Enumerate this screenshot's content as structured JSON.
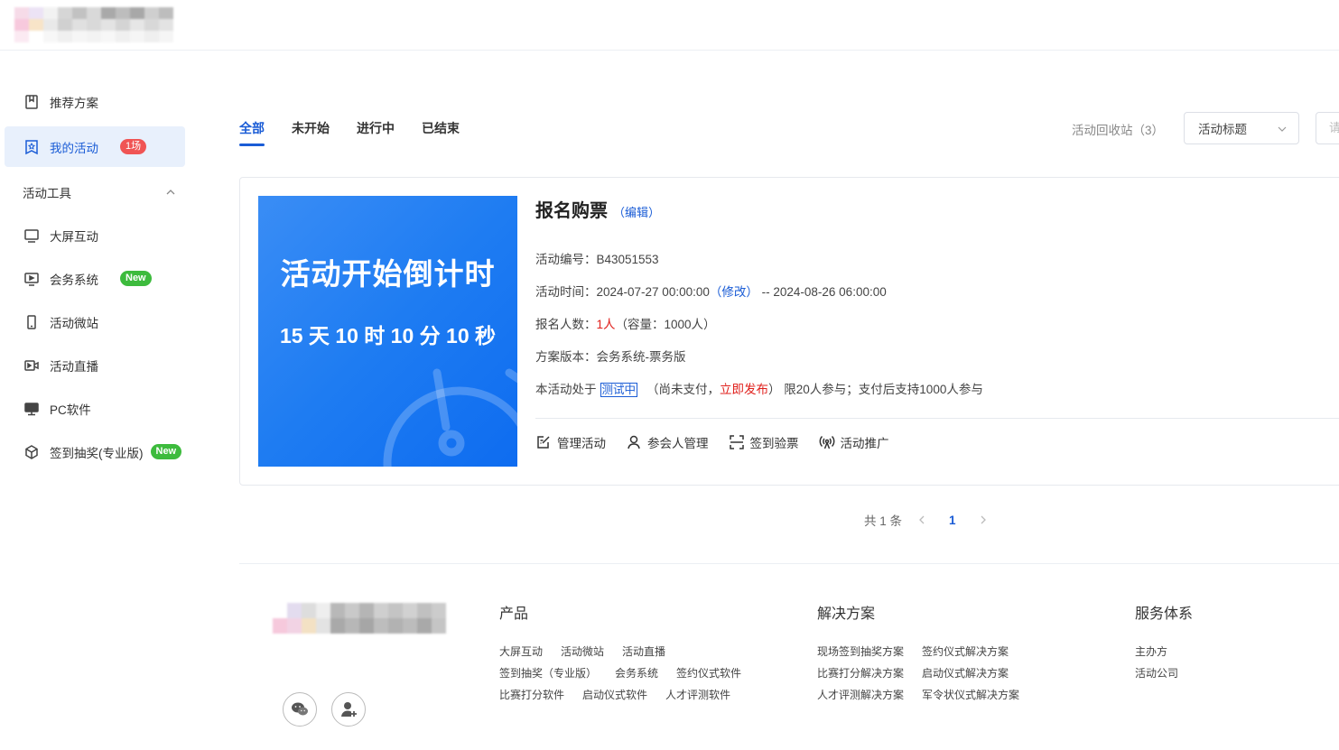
{
  "sidebar": {
    "items": [
      {
        "label": "推荐方案",
        "icon": "bookmark-icon"
      },
      {
        "label": "我的活动",
        "icon": "star-bookmark-icon",
        "badge": "1场"
      },
      {
        "label": "大屏互动",
        "icon": "monitor-icon"
      },
      {
        "label": "会务系统",
        "icon": "screen-play-icon",
        "badge": "New"
      },
      {
        "label": "活动微站",
        "icon": "phone-icon"
      },
      {
        "label": "活动直播",
        "icon": "video-icon"
      },
      {
        "label": "PC软件",
        "icon": "desktop-icon"
      },
      {
        "label": "签到抽奖(专业版)",
        "icon": "cube-icon",
        "badge": "New"
      }
    ],
    "group_label": "活动工具"
  },
  "tabs": [
    "全部",
    "未开始",
    "进行中",
    "已结束"
  ],
  "toolbar": {
    "recycle_label": "活动回收站（3）",
    "select_value": "活动标题",
    "search_placeholder": "请"
  },
  "event": {
    "cover_title": "活动开始倒计时",
    "cover_countdown": "15 天 10 时 10 分 10 秒",
    "title": "报名购票",
    "edit_label": "（编辑）",
    "id_label": "活动编号：",
    "id_value": "B43051553",
    "time_label": "活动时间：",
    "time_start": "2024-07-27 00:00:00",
    "time_modify": "（修改）",
    "time_end": "-- 2024-08-26 06:00:00",
    "signup_label": "报名人数：",
    "signup_value": "1人",
    "signup_capacity": "（容量：1000人）",
    "version_label": "方案版本：",
    "version_value": "会务系统-票务版",
    "status_prefix": "本活动处于",
    "status_tag": "测试中",
    "status_paren_open": "（尚未支付，",
    "status_publish": "立即发布",
    "status_paren_close": "）",
    "status_limit": "限20人参与；支付后支持1000人参与",
    "actions": [
      "管理活动",
      "参会人管理",
      "签到验票",
      "活动推广"
    ]
  },
  "pagination": {
    "total": "共 1 条",
    "current": "1"
  },
  "footer": {
    "col1": {
      "title": "产品",
      "links": [
        "大屏互动",
        "活动微站",
        "活动直播",
        "签到抽奖（专业版）",
        "会务系统",
        "签约仪式软件",
        "比赛打分软件",
        "启动仪式软件",
        "人才评测软件"
      ]
    },
    "col2": {
      "title": "解决方案",
      "links": [
        "现场签到抽奖方案",
        "签约仪式解决方案",
        "比赛打分解决方案",
        "启动仪式解决方案",
        "人才评测解决方案",
        "军令状仪式解决方案"
      ]
    },
    "col3": {
      "title": "服务体系",
      "links": [
        "主办方",
        "活动公司"
      ]
    }
  },
  "colors": {
    "accent": "#1a5cd6",
    "badge_red": "#f05454",
    "badge_green": "#3dbb3d",
    "cover_blue": "#1e7cf2"
  }
}
